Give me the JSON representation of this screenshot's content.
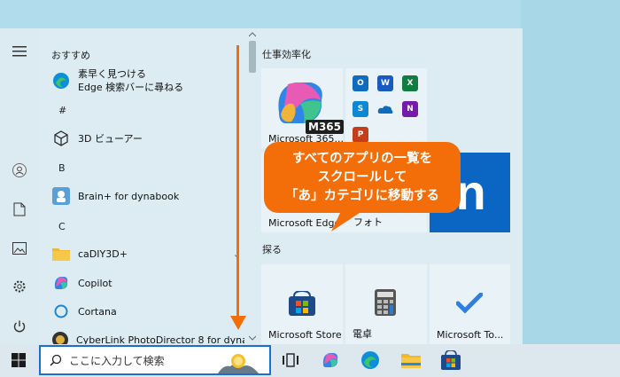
{
  "start_menu": {
    "recommended_header": "おすすめ",
    "apps": [
      {
        "label_line1": "素早く見つける",
        "label_line2": "Edge 検索バーに尋ねる",
        "icon": "edge-icon"
      },
      {
        "section": "#"
      },
      {
        "label": "3D ビューアー",
        "icon": "cube-icon"
      },
      {
        "section": "B"
      },
      {
        "label": "Brain+ for dynabook",
        "icon": "brain-icon"
      },
      {
        "section": "C"
      },
      {
        "label": "caDIY3D+",
        "icon": "folder-icon",
        "expand": "⌄"
      },
      {
        "label": "Copilot",
        "icon": "copilot-icon"
      },
      {
        "label": "Cortana",
        "icon": "cortana-icon"
      },
      {
        "label": "CyberLink PhotoDirector 8 for dynabo...",
        "icon": "photodirector-icon",
        "expand": "⌄"
      }
    ],
    "groups": [
      {
        "header": "仕事効率化"
      },
      {
        "header": "探る"
      }
    ],
    "tiles": {
      "m365_badge": "M365",
      "m365_label": "Microsoft 365...",
      "mini_apps": [
        {
          "icon": "outlook-icon",
          "letter": "O",
          "color": "#0f6cbd"
        },
        {
          "icon": "word-icon",
          "letter": "W",
          "color": "#185abd"
        },
        {
          "icon": "excel-icon",
          "letter": "X",
          "color": "#107c41"
        },
        {
          "icon": "skype-icon",
          "letter": "S",
          "color": "#0b87d4"
        },
        {
          "icon": "onedrive-icon",
          "letter": "",
          "color": "#0f6cbd"
        },
        {
          "icon": "onenote-icon",
          "letter": "N",
          "color": "#7719aa"
        },
        {
          "icon": "powerpoint-icon",
          "letter": "P",
          "color": "#c43e1c"
        }
      ],
      "edge_label": "Microsoft Edge",
      "photos_label": "フォト",
      "linkedin_logo": "in",
      "store_label": "Microsoft Store",
      "calc_label": "電卓",
      "todo_label": "Microsoft To..."
    }
  },
  "callout": {
    "line1": "すべてのアプリの一覧を",
    "line2": "スクロールして",
    "line3": "「あ」カテゴリに移動する",
    "color": "#f36d08"
  },
  "taskbar": {
    "search_placeholder": "ここに入力して検索",
    "icons": [
      "windows-icon",
      "task-view-icon",
      "copilot-icon",
      "edge-icon",
      "file-explorer-icon",
      "store-icon"
    ]
  },
  "colors": {
    "accent": "#f36d08",
    "start_bg": "#ddecf2",
    "desktop": "#b0dceb",
    "linkedin": "#0a66c2"
  }
}
